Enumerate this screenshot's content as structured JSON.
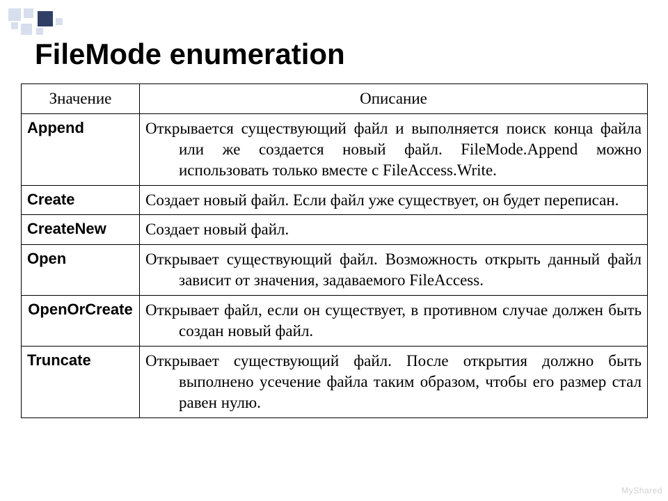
{
  "title": "FileMode enumeration",
  "table": {
    "headers": {
      "value": "Значение",
      "desc": "Описание"
    },
    "rows": [
      {
        "value": "Append",
        "desc": "Открывается существующий файл и выполняется поиск конца файла или же создается новый файл. FileMode.Append можно использовать только вместе с FileAccess.Write."
      },
      {
        "value": "Create",
        "desc": "Создает новый файл. Если файл уже существует, он будет переписан."
      },
      {
        "value": "CreateNew",
        "desc": "Создает новый файл."
      },
      {
        "value": "Open",
        "desc": "Открывает существующий файл. Возможность открыть данный файл зависит от значения, задаваемого FileAccess."
      },
      {
        "value": "OpenOrCreate",
        "desc": "Открывает файл, если он существует, в противном случае должен быть создан новый файл."
      },
      {
        "value": "Truncate",
        "desc": "Открывает существующий файл. После открытия должно быть выполнено усечение файла таким образом, чтобы его размер стал равен нулю."
      }
    ]
  },
  "watermark": "MyShared"
}
